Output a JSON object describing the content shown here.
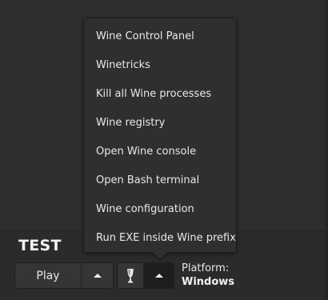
{
  "game": {
    "title": "TEST"
  },
  "actions": {
    "play_label": "Play",
    "wine_icon": "wine-glass-icon"
  },
  "platform": {
    "label": "Platform:",
    "value": "Windows"
  },
  "wine_menu": {
    "items": [
      "Wine Control Panel",
      "Winetricks",
      "Kill all Wine processes",
      "Wine registry",
      "Open Wine console",
      "Open Bash terminal",
      "Wine configuration",
      "Run EXE inside Wine prefix"
    ]
  }
}
